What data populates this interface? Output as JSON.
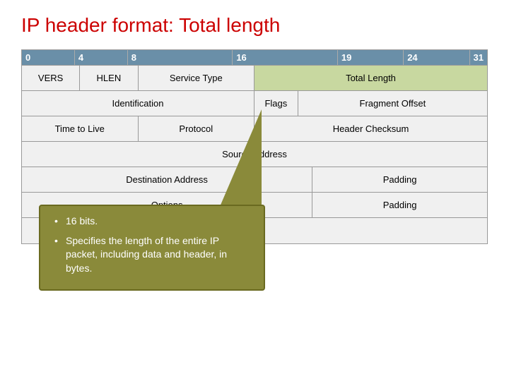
{
  "title": "IP header format: Total length",
  "bits": {
    "positions": [
      "0",
      "4",
      "8",
      "16",
      "19",
      "24",
      "31"
    ]
  },
  "rows": {
    "bit_row": [
      "0",
      "4",
      "8",
      "16",
      "19",
      "24",
      "31"
    ],
    "row1": {
      "vers": "VERS",
      "hlen": "HLEN",
      "service_type": "Service Type",
      "total_length": "Total Length"
    },
    "row2": {
      "identification": "Identification",
      "flags": "Flags",
      "fragment_offset": "Fragment Offset"
    },
    "row3": {
      "ttl": "Time to Live",
      "protocol": "Protocol",
      "header_checksum": "Header Checksum"
    },
    "row4": {
      "source": "Source Address"
    },
    "row5": {
      "destination": "Destination Address",
      "padding": "Padding"
    },
    "row6": {
      "options": "Options",
      "padding": "Padding"
    },
    "row7": {
      "dots": "..."
    }
  },
  "callout": {
    "bullet1": "16 bits.",
    "bullet2": "Specifies the length of the entire IP packet, including data and header, in bytes."
  }
}
